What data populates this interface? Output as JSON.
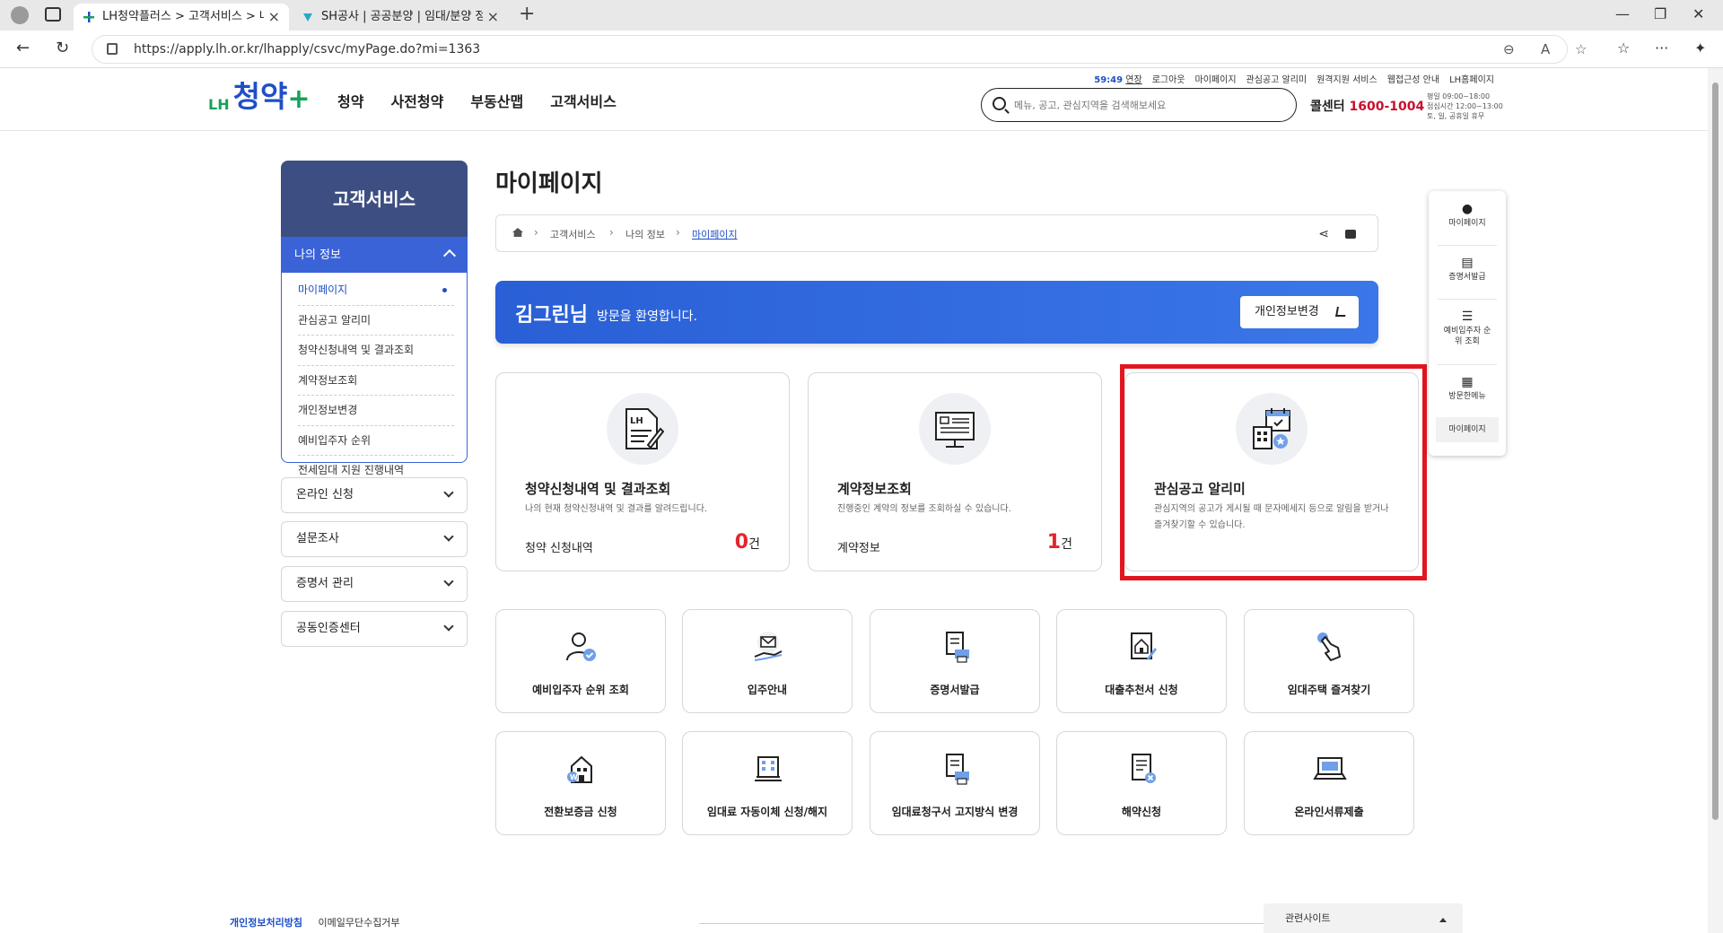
{
  "browser": {
    "tabs": [
      {
        "title": "LH청약플러스 > 고객서비스 > 나의 정보",
        "active": true
      },
      {
        "title": "SH공사 | 공공분양 | 임대/분양 정보",
        "active": false
      }
    ],
    "url": "https://apply.lh.or.kr/lhapply/csvc/myPage.do?mi=1363"
  },
  "header": {
    "util": {
      "time": "59:49",
      "extend": "연장",
      "links": [
        "로그아웃",
        "마이페이지",
        "관심공고 알리미",
        "원격지원 서비스",
        "웹접근성 안내",
        "LH홈페이지"
      ]
    },
    "logo": {
      "lh": "LH",
      "main": "청약",
      "plus": "+"
    },
    "gnb": [
      "청약",
      "사전청약",
      "부동산맵",
      "고객서비스"
    ],
    "search_placeholder": "메뉴, 공고, 관심지역을 검색해보세요",
    "call_center_label": "콜센터",
    "call_center_number": "1600-1004",
    "hours": [
      "평일 09:00~18:00",
      "점심시간 12:00~13:00",
      "토, 일, 공휴일 휴무"
    ]
  },
  "lnb": {
    "title": "고객서비스",
    "selected": "나의 정보",
    "items": [
      "마이페이지",
      "관심공고 알리미",
      "청약신청내역 및 결과조회",
      "계약정보조회",
      "개인정보변경",
      "예비입주자 순위",
      "전세임대 지원 진행내역"
    ],
    "groups": [
      "온라인 신청",
      "설문조사",
      "증명서 관리",
      "공동인증센터"
    ]
  },
  "main": {
    "page_title": "마이페이지",
    "breadcrumb": [
      "고객서비스",
      "나의 정보",
      "마이페이지"
    ],
    "welcome": {
      "name": "김그린님",
      "rest": "방문을 환영합니다.",
      "edit_button": "개인정보변경"
    },
    "cards": [
      {
        "title": "청약신청내역 및 결과조회",
        "desc": "나의 현재 청약신청내역 및 결과를 알려드립니다.",
        "footer_label": "청약 신청내역",
        "count": "0",
        "unit": "건"
      },
      {
        "title": "계약정보조회",
        "desc": "진행중인 계약의 정보를 조회하실 수 있습니다.",
        "footer_label": "계약정보",
        "count": "1",
        "unit": "건"
      },
      {
        "title": "관심공고 알리미",
        "desc": "관심지역의 공고가 게시될 때 문자메세지 등으로 알림을 받거나 즐겨찾기할 수 있습니다."
      }
    ],
    "quick_row1": [
      "예비입주자 순위 조회",
      "입주안내",
      "증명서발급",
      "대출추천서 신청",
      "임대주택 즐겨찾기"
    ],
    "quick_row2": [
      "전환보증금 신청",
      "임대료 자동이체 신청/해지",
      "임대료청구서 고지방식 변경",
      "해약신청",
      "온라인서류제출"
    ]
  },
  "quick_menu": {
    "items": [
      {
        "icon": "person-icon",
        "label": "마이페이지"
      },
      {
        "icon": "document-icon",
        "label": "증명서발급"
      },
      {
        "icon": "list-icon",
        "label": "예비입주자 순위 조회"
      },
      {
        "icon": "grid-icon",
        "label": "방문한메뉴"
      }
    ],
    "last": "마이페이지"
  },
  "footer": {
    "privacy": "개인정보처리방침",
    "email_refusal": "이메일무단수집거부",
    "related": "관련사이트"
  },
  "colors": {
    "brand_blue": "#1e4fc7",
    "brand_green": "#18a15b",
    "highlight_red": "#e3161f",
    "count_red": "#e3262c"
  }
}
